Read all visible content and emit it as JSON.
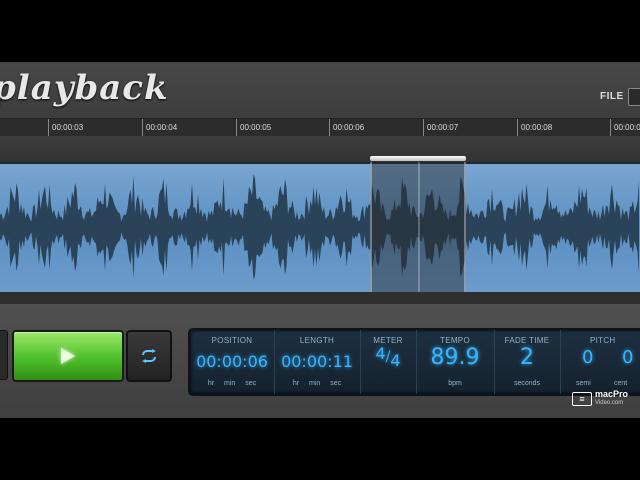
{
  "app": {
    "title": "playback",
    "menu_file": "FILE"
  },
  "ruler": {
    "ticks": [
      "00:00:03",
      "00:00:04",
      "00:00:05",
      "00:00:06",
      "00:00:07",
      "00:00:08",
      "00:00:0"
    ]
  },
  "colors": {
    "waveform_bg": "#6d9ccc",
    "waveform": "#2b4359",
    "play_button": "#4fbf2a",
    "lcd_text": "#37b4ff"
  },
  "transport": {
    "play_icon": "play-icon",
    "loop_icon": "loop-icon"
  },
  "display": {
    "position": {
      "label": "POSITION",
      "value": "00:00:06",
      "units": "hr min sec"
    },
    "length": {
      "label": "LENGTH",
      "value": "00:00:11",
      "units": "hr min sec"
    },
    "meter": {
      "label": "METER",
      "numerator": "4",
      "denominator": "4"
    },
    "tempo": {
      "label": "TEMPO",
      "value": "89.9",
      "unit": "bpm"
    },
    "fade_time": {
      "label": "FADE TIME",
      "value": "2",
      "unit": "seconds"
    },
    "pitch": {
      "label": "PITCH",
      "semi": "0",
      "cent": "0",
      "semi_label": "semi",
      "cent_label": "cent"
    }
  },
  "watermark": {
    "brand": "macPro",
    "sub": "Video.com"
  }
}
